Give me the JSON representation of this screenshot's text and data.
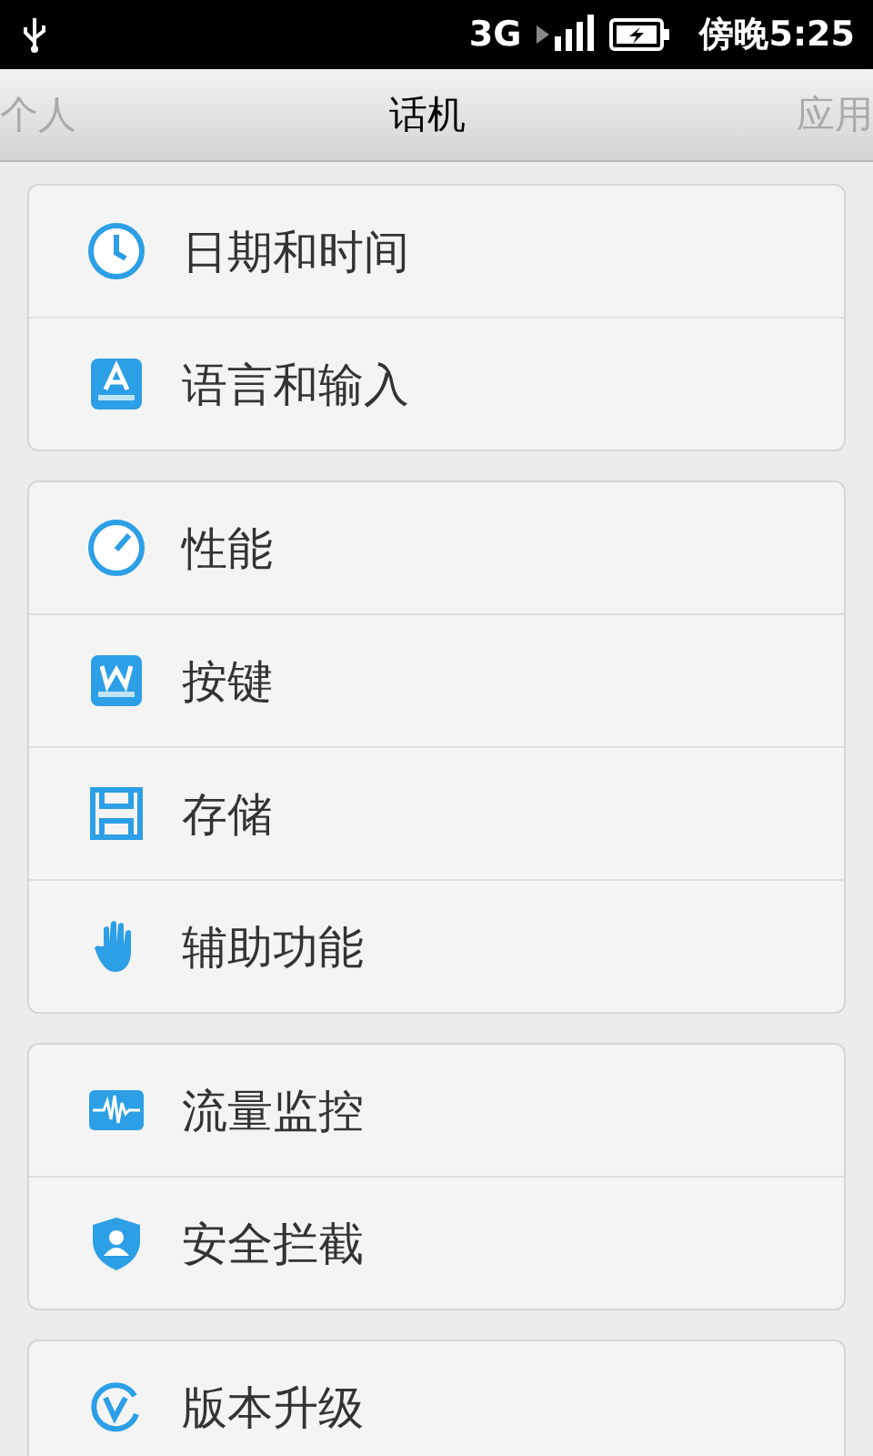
{
  "status_bar": {
    "network": "3G",
    "time": "傍晚5:25"
  },
  "tabs": [
    {
      "label": "个人",
      "selected": false
    },
    {
      "label": "话机",
      "selected": true
    },
    {
      "label": "应用",
      "selected": false
    }
  ],
  "groups": [
    {
      "items": [
        {
          "label": "日期和时间"
        },
        {
          "label": "语言和输入"
        }
      ]
    },
    {
      "items": [
        {
          "label": "性能"
        },
        {
          "label": "按键"
        },
        {
          "label": "存储"
        },
        {
          "label": "辅助功能"
        }
      ]
    },
    {
      "items": [
        {
          "label": "流量监控"
        },
        {
          "label": "安全拦截"
        }
      ]
    },
    {
      "items": [
        {
          "label": "版本升级"
        }
      ]
    }
  ]
}
